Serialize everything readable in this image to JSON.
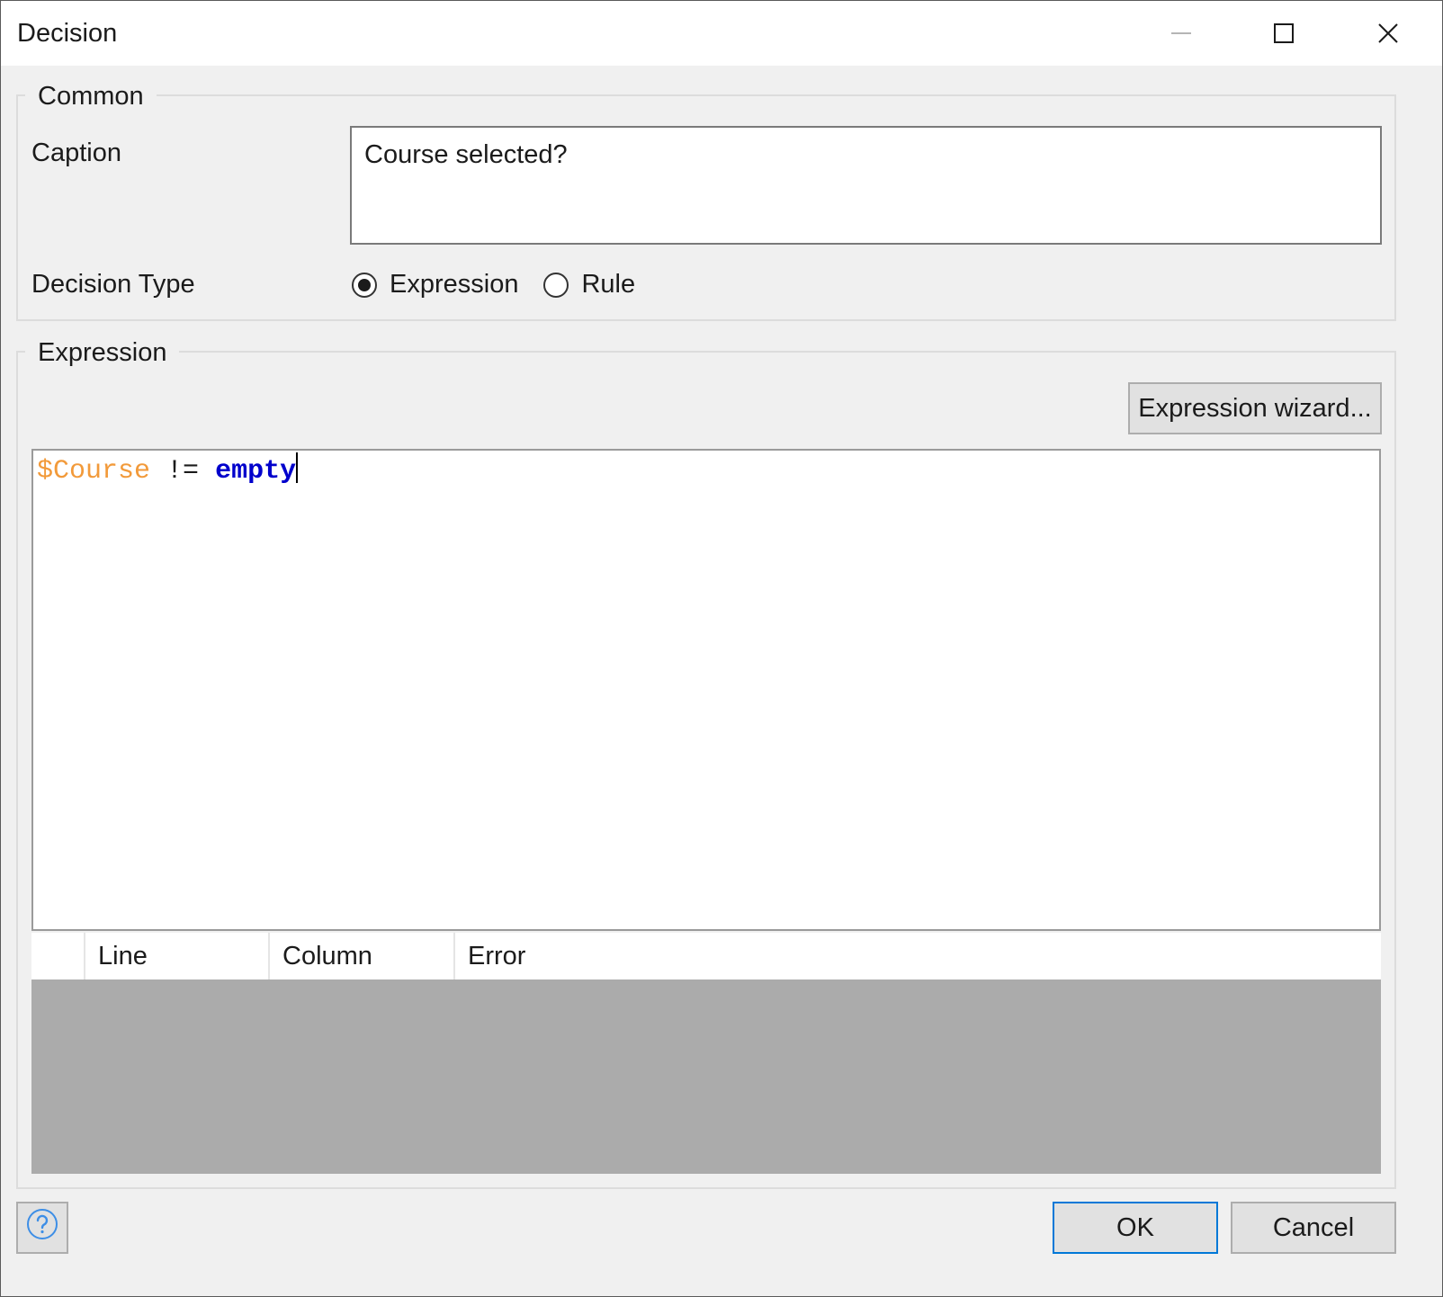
{
  "window": {
    "title": "Decision",
    "minimize_icon": "minimize-icon",
    "maximize_icon": "maximize-icon",
    "close_icon": "close-icon"
  },
  "common": {
    "legend": "Common",
    "caption_label": "Caption",
    "caption_value": "Course selected?",
    "decision_type_label": "Decision Type",
    "decision_types": [
      {
        "label": "Expression",
        "selected": true
      },
      {
        "label": "Rule",
        "selected": false
      }
    ]
  },
  "expression": {
    "legend": "Expression",
    "wizard_button": "Expression wizard...",
    "code": {
      "variable": "$Course",
      "operator": "!=",
      "keyword": "empty"
    },
    "token_colors": {
      "variable": "#f29a3a",
      "keyword": "#0000cc"
    },
    "errors": {
      "columns": [
        "",
        "Line",
        "Column",
        "Error"
      ],
      "rows": []
    }
  },
  "footer": {
    "help_icon": "help-icon",
    "ok_button": "OK",
    "cancel_button": "Cancel"
  }
}
